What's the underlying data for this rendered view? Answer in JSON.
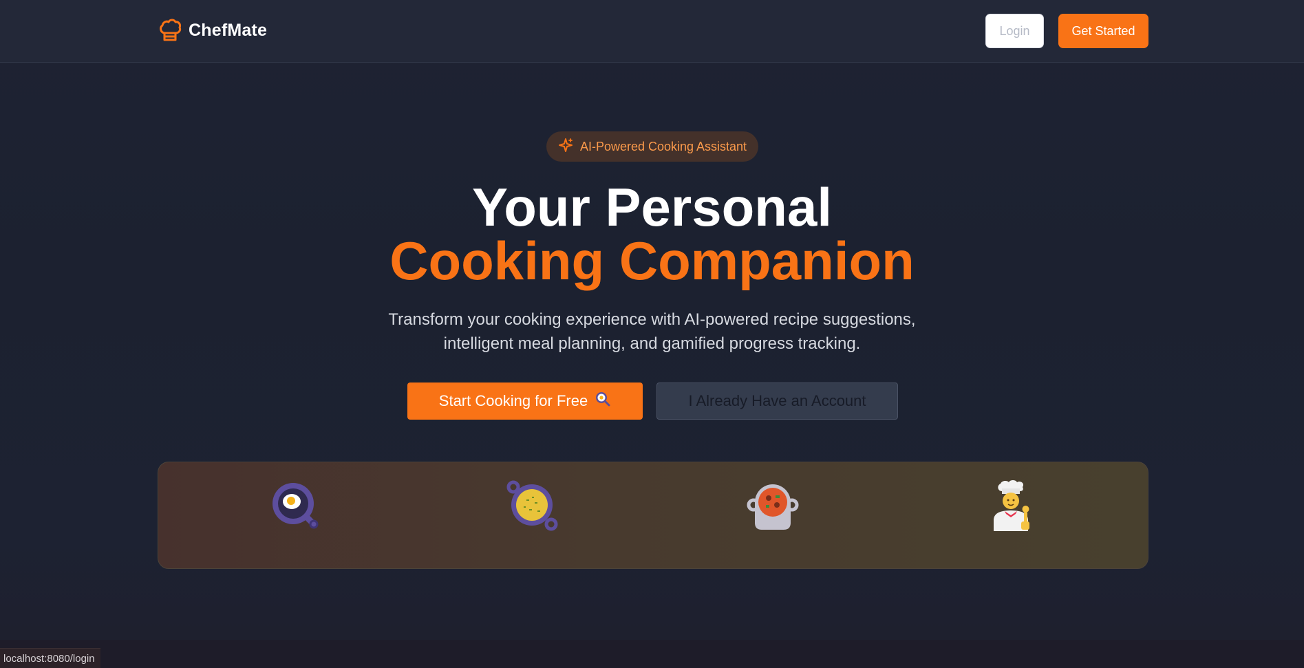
{
  "header": {
    "brand_name": "ChefMate",
    "brand_icon": "chef-hat-icon",
    "login_label": "Login",
    "get_started_label": "Get Started"
  },
  "hero": {
    "badge_label": "AI-Powered Cooking Assistant",
    "badge_icon": "sparkles-icon",
    "title_line1": "Your Personal",
    "title_line2": "Cooking Companion",
    "subtitle_line1": "Transform your cooking experience with AI-powered recipe suggestions,",
    "subtitle_line2": "intelligent meal planning, and gamified progress tracking.",
    "primary_cta": "Start Cooking for Free",
    "primary_cta_icon": "frying-pan-emoji",
    "secondary_cta": "I Already Have an Account"
  },
  "features": {
    "icons": [
      "frying-pan-egg-icon",
      "paella-pan-icon",
      "stew-pot-icon",
      "chef-icon"
    ]
  },
  "statusbar": {
    "url": "localhost:8080/login"
  },
  "colors": {
    "accent": "#f97316",
    "background": "#1c2130",
    "header": "#232838",
    "badge_bg": "#44312a",
    "badge_text": "#fb9a4b"
  }
}
